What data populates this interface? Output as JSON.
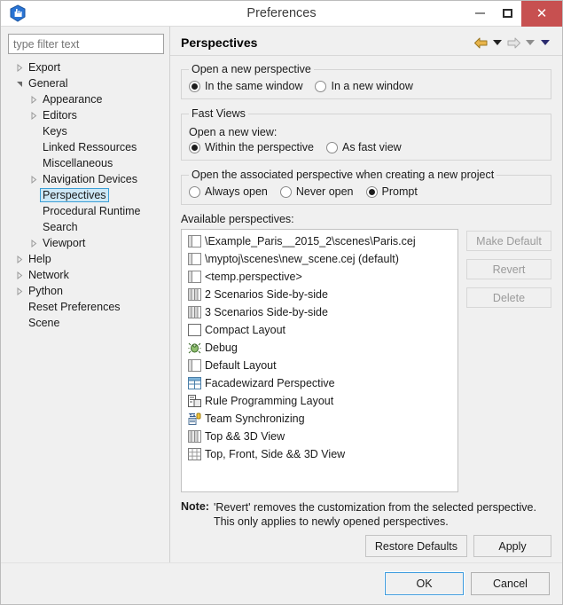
{
  "window": {
    "title": "Preferences",
    "app_icon": "cityengine-logo-icon",
    "minimize_label": "Minimize",
    "maximize_label": "Maximize",
    "close_label": "Close"
  },
  "filter": {
    "placeholder": "type filter text",
    "value": ""
  },
  "tree": {
    "items": [
      {
        "label": "Export",
        "indent": 0,
        "arrow": "collapsed",
        "selected": false
      },
      {
        "label": "General",
        "indent": 0,
        "arrow": "expanded",
        "selected": false
      },
      {
        "label": "Appearance",
        "indent": 1,
        "arrow": "collapsed",
        "selected": false
      },
      {
        "label": "Editors",
        "indent": 1,
        "arrow": "collapsed",
        "selected": false
      },
      {
        "label": "Keys",
        "indent": 1,
        "arrow": "none",
        "selected": false
      },
      {
        "label": "Linked Ressources",
        "indent": 1,
        "arrow": "none",
        "selected": false
      },
      {
        "label": "Miscellaneous",
        "indent": 1,
        "arrow": "none",
        "selected": false
      },
      {
        "label": "Navigation Devices",
        "indent": 1,
        "arrow": "collapsed",
        "selected": false
      },
      {
        "label": "Perspectives",
        "indent": 1,
        "arrow": "none",
        "selected": true
      },
      {
        "label": "Procedural Runtime",
        "indent": 1,
        "arrow": "none",
        "selected": false
      },
      {
        "label": "Search",
        "indent": 1,
        "arrow": "none",
        "selected": false
      },
      {
        "label": "Viewport",
        "indent": 1,
        "arrow": "collapsed",
        "selected": false
      },
      {
        "label": "Help",
        "indent": 0,
        "arrow": "collapsed",
        "selected": false
      },
      {
        "label": "Network",
        "indent": 0,
        "arrow": "collapsed",
        "selected": false
      },
      {
        "label": "Python",
        "indent": 0,
        "arrow": "collapsed",
        "selected": false
      },
      {
        "label": "Reset Preferences",
        "indent": 0,
        "arrow": "none",
        "selected": false
      },
      {
        "label": "Scene",
        "indent": 0,
        "arrow": "none",
        "selected": false
      }
    ]
  },
  "page": {
    "title": "Perspectives",
    "nav": {
      "back_icon": "back-arrow-icon",
      "back_menu_icon": "chevron-down-icon",
      "forward_icon": "forward-arrow-icon",
      "forward_menu_icon": "chevron-down-icon",
      "more_icon": "chevron-down-icon"
    }
  },
  "group_open_perspective": {
    "legend": "Open a new perspective",
    "options": [
      {
        "label": "In the same window",
        "checked": true
      },
      {
        "label": "In a new window",
        "checked": false
      }
    ]
  },
  "group_fast_views": {
    "legend": "Fast Views",
    "sublabel": "Open a new view:",
    "options": [
      {
        "label": "Within the perspective",
        "checked": true
      },
      {
        "label": "As fast view",
        "checked": false
      }
    ]
  },
  "group_associated_perspective": {
    "legend": "Open the associated perspective when creating a new project",
    "options": [
      {
        "label": "Always open",
        "checked": false
      },
      {
        "label": "Never open",
        "checked": false
      },
      {
        "label": "Prompt",
        "checked": true
      }
    ]
  },
  "available": {
    "label": "Available perspectives:",
    "items": [
      {
        "label": "\\Example_Paris__2015_2\\scenes\\Paris.cej",
        "icon": "layout-two-pane-icon"
      },
      {
        "label": "\\myptoj\\scenes\\new_scene.cej (default)",
        "icon": "layout-two-pane-icon"
      },
      {
        "label": "<temp.perspective>",
        "icon": "layout-two-pane-icon"
      },
      {
        "label": "2 Scenarios Side-by-side",
        "icon": "layout-columns-icon"
      },
      {
        "label": "3 Scenarios Side-by-side",
        "icon": "layout-columns-icon"
      },
      {
        "label": "Compact Layout",
        "icon": "layout-single-pane-icon"
      },
      {
        "label": "Debug",
        "icon": "debug-bug-icon"
      },
      {
        "label": "Default Layout",
        "icon": "layout-two-pane-icon"
      },
      {
        "label": "Facadewizard Perspective",
        "icon": "layout-table-icon"
      },
      {
        "label": "Rule Programming Layout",
        "icon": "layout-rule-editor-icon"
      },
      {
        "label": "Team Synchronizing",
        "icon": "team-sync-icon"
      },
      {
        "label": "Top && 3D View",
        "icon": "layout-columns-icon"
      },
      {
        "label": "Top, Front, Side && 3D View",
        "icon": "layout-grid-icon"
      }
    ],
    "buttons": [
      {
        "label": "Make Default",
        "enabled": false
      },
      {
        "label": "Revert",
        "enabled": false
      },
      {
        "label": "Delete",
        "enabled": false
      }
    ]
  },
  "note": {
    "label": "Note:",
    "line1": "'Revert' removes the customization from the selected perspective.",
    "line2": "This only applies to newly opened perspectives."
  },
  "actions": {
    "restore_defaults": "Restore Defaults",
    "apply": "Apply",
    "ok": "OK",
    "cancel": "Cancel"
  },
  "colors": {
    "accent_blue": "#3a9ade",
    "close_red": "#c75050",
    "selection_blue": "#cde8f6",
    "back_arrow_gold": "#e8b44a",
    "forward_arrow_gray": "#d8d8d8"
  }
}
